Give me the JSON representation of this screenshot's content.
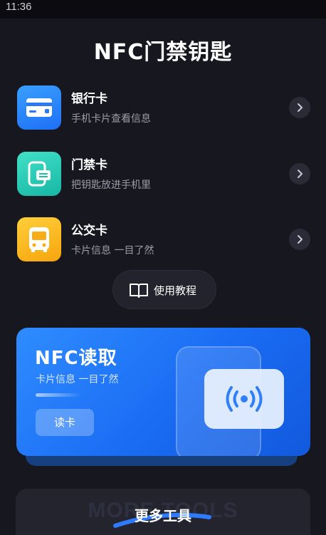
{
  "status_bar": {
    "time": "11:36"
  },
  "page": {
    "title": "NFC门禁钥匙"
  },
  "cards": [
    {
      "title": "银行卡",
      "subtitle": "手机卡片查看信息",
      "icon": "bank-card-icon",
      "color": "#2f86fb"
    },
    {
      "title": "门禁卡",
      "subtitle": "把钥匙放进手机里",
      "icon": "access-card-icon",
      "color": "#2dccb7"
    },
    {
      "title": "公交卡",
      "subtitle": "卡片信息 一目了然",
      "icon": "bus-icon",
      "color": "#fbb921"
    }
  ],
  "tutorial": {
    "label": "使用教程",
    "icon": "book-icon"
  },
  "nfc_read": {
    "title": "NFC读取",
    "subtitle": "卡片信息 一目了然",
    "button_label": "读卡",
    "icon": "nfc-signal-icon",
    "accent": "#1a6cf3"
  },
  "more_tools": {
    "watermark": "MORE TOOLS",
    "title": "更多工具",
    "accent": "#2f7bff"
  }
}
